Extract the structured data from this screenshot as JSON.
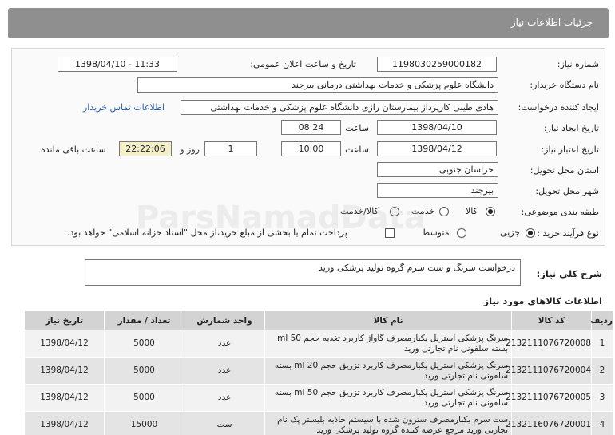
{
  "header": {
    "title": "جزئیات اطلاعات نیاز"
  },
  "fields": {
    "need_number_label": "شماره نیاز:",
    "need_number": "1198030259000182",
    "announce_label": "تاریخ و ساعت اعلان عمومی:",
    "announce_value": "1398/04/10 - 11:33",
    "buyer_label": "نام دستگاه خریدار:",
    "buyer": "دانشگاه علوم پزشکی و خدمات بهداشتی درمانی بیرجند",
    "requester_label": "ایجاد کننده درخواست:",
    "requester": "هادی طیبی کارپرداز بیمارستان رازی دانشگاه علوم پزشکی و خدمات بهداشتی",
    "contact_link": "اطلاعات تماس خریدار",
    "created_label": "تاریخ ایجاد نیاز:",
    "created_date": "1398/04/10",
    "created_time_label": "ساعت",
    "created_time": "08:24",
    "valid_label": "تاریخ اعتبار نیاز:",
    "valid_date": "1398/04/12",
    "valid_time_label": "ساعت",
    "valid_time": "10:00",
    "days": "1",
    "days_label": "روز و",
    "remaining": "22:22:06",
    "remaining_label": "ساعت باقی مانده",
    "province_label": "استان محل تحویل:",
    "province": "خراسان جنوبی",
    "city_label": "شهر محل تحویل:",
    "city": "بیرجند",
    "category_label": "طبقه بندی موضوعی:",
    "category_options": [
      "کالا",
      "خدمت",
      "کالا/خدمت"
    ],
    "process_label": "نوع فرآیند خرید :",
    "process_options": [
      "جزیی",
      "متوسط"
    ],
    "payment_note": "پرداخت تمام یا بخشی از مبلغ خرید،از محل \"اسناد خزانه اسلامی\" خواهد بود."
  },
  "description": {
    "label": "شرح کلی نیاز:",
    "text": "درخواست سرنگ و ست سرم گروه تولید پزشکی ورید"
  },
  "items": {
    "title": "اطلاعات کالاهای مورد نیاز",
    "headers": [
      "ردیف",
      "کد کالا",
      "نام کالا",
      "واحد شمارش",
      "تعداد / مقدار",
      "تاریخ نیاز"
    ],
    "rows": [
      {
        "row": "1",
        "code": "2132111076720008",
        "name": "سرنگ پزشکی استریل یکبارمصرف گاواژ کاربرد تغذیه حجم 50 ml بسته سلفونی نام تجارتی ورید",
        "unit": "عدد",
        "qty": "5000",
        "date": "1398/04/12"
      },
      {
        "row": "2",
        "code": "2132111076720004",
        "name": "سرنگ پزشکی استریل یکبارمصرف کاربرد تزریق حجم 20 ml بسته سلفونی نام تجارتی ورید",
        "unit": "عدد",
        "qty": "5000",
        "date": "1398/04/12"
      },
      {
        "row": "3",
        "code": "2132111076720005",
        "name": "سرنگ پزشکی استریل یکبارمصرف کاربرد تزریق حجم 50 ml بسته سلفونی نام تجارتی ورید",
        "unit": "عدد",
        "qty": "5000",
        "date": "1398/04/12"
      },
      {
        "row": "4",
        "code": "2132116076720001",
        "name": "ست سرم یکبارمصرف سترون شده با سیستم جاذبه بلیستر پک نام تجارتی ورید مرجع عرضه کننده گروه تولید پزشکی ورید",
        "unit": "ست",
        "qty": "15000",
        "date": "1398/04/12"
      }
    ]
  }
}
